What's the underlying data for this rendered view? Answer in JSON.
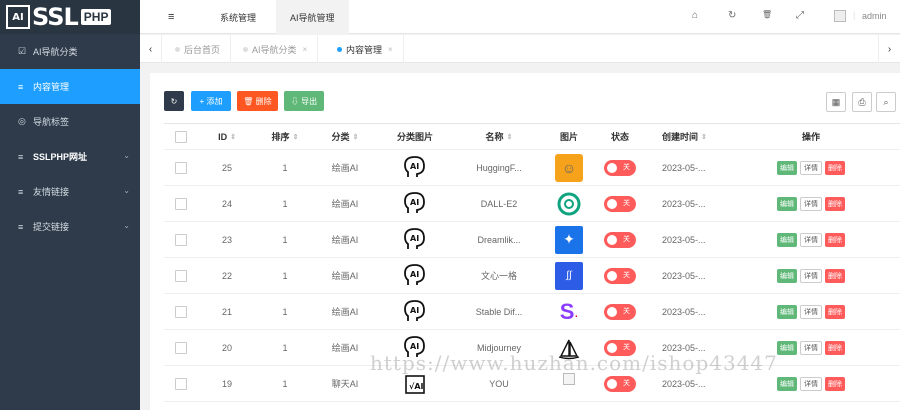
{
  "logo": {
    "chip": "AI",
    "text": "SSL",
    "php": "PHP"
  },
  "sidebar": {
    "items": [
      {
        "icon": "☑",
        "label": "AI导航分类",
        "active": false,
        "arrow": ""
      },
      {
        "icon": "≡",
        "label": "内容管理",
        "active": true,
        "arrow": ""
      },
      {
        "icon": "◎",
        "label": "导航标签",
        "active": false,
        "arrow": ""
      },
      {
        "icon": "≡",
        "label": "SSLPHP网址",
        "active": false,
        "arrow": "⌄"
      },
      {
        "icon": "≡",
        "label": "友情链接",
        "active": false,
        "arrow": "⌄"
      },
      {
        "icon": "≡",
        "label": "提交链接",
        "active": false,
        "arrow": "⌄"
      }
    ]
  },
  "topbar": {
    "menu_icon": "≡",
    "tab1": "系统管理",
    "tab2": "AI导航管理",
    "home_icon": "⌂",
    "refresh_icon": "↻",
    "clear_icon": "🗑",
    "fullscreen_icon": "⤢",
    "admin": "admin"
  },
  "pagetabs": {
    "prev": "‹",
    "next": "›",
    "tabs": [
      {
        "label": "后台首页",
        "close": ""
      },
      {
        "label": "AI导航分类",
        "close": "×"
      },
      {
        "label": "内容管理",
        "close": "×"
      }
    ]
  },
  "toolbar": {
    "refresh": "↻",
    "add": "+ 添加",
    "delete": "🗑 删除",
    "export": "⇩ 导出",
    "cols_icon": "▦",
    "print_icon": "⎙",
    "search_icon": "⌕"
  },
  "table": {
    "headers": {
      "id": "ID",
      "sort": "排序",
      "cat": "分类",
      "catimg": "分类图片",
      "name": "名称",
      "img": "图片",
      "status": "状态",
      "time": "创建时间",
      "ops": "操作"
    },
    "sort_arrows": "⇕",
    "rows": [
      {
        "id": "25",
        "sort": "1",
        "cat": "绘画AI",
        "name": "HuggingF...",
        "status": "关",
        "time": "2023-05-..."
      },
      {
        "id": "24",
        "sort": "1",
        "cat": "绘画AI",
        "name": "DALL-E2",
        "status": "关",
        "time": "2023-05-..."
      },
      {
        "id": "23",
        "sort": "1",
        "cat": "绘画AI",
        "name": "Dreamlik...",
        "status": "关",
        "time": "2023-05-..."
      },
      {
        "id": "22",
        "sort": "1",
        "cat": "绘画AI",
        "name": "文心一格",
        "status": "关",
        "time": "2023-05-..."
      },
      {
        "id": "21",
        "sort": "1",
        "cat": "绘画AI",
        "name": "Stable Dif...",
        "status": "关",
        "time": "2023-05-..."
      },
      {
        "id": "20",
        "sort": "1",
        "cat": "绘画AI",
        "name": "Midjourney",
        "status": "关",
        "time": "2023-05-..."
      },
      {
        "id": "19",
        "sort": "1",
        "cat": "聊天AI",
        "name": "YOU",
        "status": "关",
        "time": "2023-05-..."
      }
    ],
    "ops": {
      "edit": "编辑",
      "detail": "详情",
      "del": "删除"
    }
  },
  "watermark": "https://www.huzhan.com/ishop43447",
  "colors": {
    "sidebar": "#2f3b4a",
    "accent": "#1e9fff",
    "danger": "#ff5722",
    "success": "#5fb878"
  }
}
